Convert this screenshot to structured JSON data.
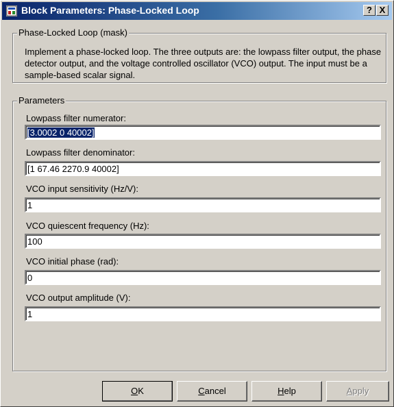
{
  "window": {
    "title": "Block Parameters: Phase-Locked Loop",
    "help_button": "?",
    "close_button": "X"
  },
  "mask_group": {
    "legend": "Phase-Locked Loop (mask)",
    "description": "Implement a phase-locked loop.  The three outputs are:  the lowpass filter output, the phase detector output, and the voltage controlled oscillator (VCO) output.  The input must be a sample-based scalar signal."
  },
  "params_group": {
    "legend": "Parameters",
    "fields": [
      {
        "label": "Lowpass filter numerator:",
        "value": "[3.0002  0  40002]"
      },
      {
        "label": "Lowpass filter denominator:",
        "value": "[1   67.46   2270.9   40002]"
      },
      {
        "label": "VCO input sensitivity (Hz/V):",
        "value": "1"
      },
      {
        "label": "VCO quiescent frequency (Hz):",
        "value": "100"
      },
      {
        "label": "VCO initial phase (rad):",
        "value": "0"
      },
      {
        "label": "VCO output amplitude (V):",
        "value": "1"
      }
    ]
  },
  "buttons": {
    "ok": {
      "mnemonic": "O",
      "rest": "K"
    },
    "cancel": {
      "mnemonic": "C",
      "rest": "ancel"
    },
    "help": {
      "mnemonic": "H",
      "rest": "elp"
    },
    "apply": {
      "mnemonic": "A",
      "rest": "pply",
      "enabled": false
    }
  },
  "colors": {
    "dialog_bg": "#d4d0c8",
    "titlebar_start": "#0a246a",
    "titlebar_end": "#a6caf0",
    "selection": "#0a246a"
  },
  "icons": {
    "title": "simulink-block-icon"
  }
}
